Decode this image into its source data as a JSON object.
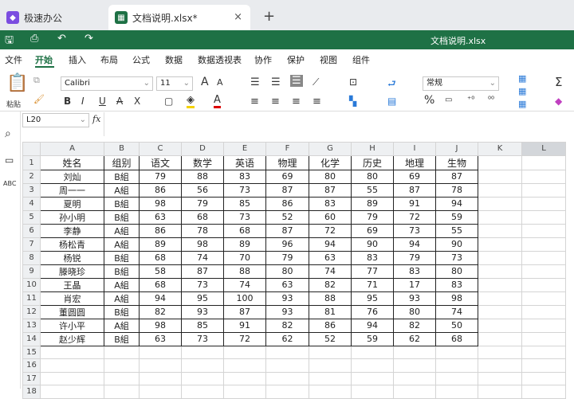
{
  "tabs": [
    {
      "label": "极速办公"
    },
    {
      "label": "文档说明.xlsx*",
      "close": "×"
    }
  ],
  "new_tab": "+",
  "doc_title": "文档说明.xlsx",
  "menu": [
    "文件",
    "开始",
    "插入",
    "布局",
    "公式",
    "数据",
    "数据透视表",
    "协作",
    "保护",
    "视图",
    "组件"
  ],
  "ribbon": {
    "paste": "粘贴",
    "font": "Calibri",
    "size": "11",
    "grow": "A",
    "shrink": "A",
    "bold": "B",
    "italic": "I",
    "underline": "U",
    "strike": "A",
    "sub": "X",
    "fontcolor": "A",
    "numfmt": "常规",
    "percent": "%",
    "sigma": "Σ"
  },
  "formula": {
    "cellref": "L20",
    "fx": "fx",
    "value": ""
  },
  "columns": [
    "",
    "A",
    "B",
    "C",
    "D",
    "E",
    "F",
    "G",
    "H",
    "I",
    "J",
    "K",
    "L"
  ],
  "rows": [
    [
      "1",
      "姓名",
      "组别",
      "语文",
      "数学",
      "英语",
      "物理",
      "化学",
      "历史",
      "地理",
      "生物"
    ],
    [
      "2",
      "刘灿",
      "B組",
      "79",
      "88",
      "83",
      "69",
      "80",
      "80",
      "69",
      "87"
    ],
    [
      "3",
      "周一一",
      "A組",
      "86",
      "56",
      "73",
      "87",
      "87",
      "55",
      "87",
      "78"
    ],
    [
      "4",
      "夏明",
      "B組",
      "98",
      "79",
      "85",
      "86",
      "83",
      "89",
      "91",
      "94"
    ],
    [
      "5",
      "孙小明",
      "B組",
      "63",
      "68",
      "73",
      "52",
      "60",
      "79",
      "72",
      "59"
    ],
    [
      "6",
      "李静",
      "A組",
      "86",
      "78",
      "68",
      "87",
      "72",
      "69",
      "73",
      "55"
    ],
    [
      "7",
      "杨松青",
      "A組",
      "89",
      "98",
      "89",
      "96",
      "94",
      "90",
      "94",
      "90"
    ],
    [
      "8",
      "杨锐",
      "B組",
      "68",
      "74",
      "70",
      "79",
      "63",
      "83",
      "79",
      "73"
    ],
    [
      "9",
      "滕晓珍",
      "B組",
      "58",
      "87",
      "88",
      "80",
      "74",
      "77",
      "83",
      "80"
    ],
    [
      "10",
      "王晶",
      "A組",
      "68",
      "73",
      "74",
      "63",
      "82",
      "71",
      "17",
      "83"
    ],
    [
      "11",
      "肖宏",
      "A組",
      "94",
      "95",
      "100",
      "93",
      "88",
      "95",
      "93",
      "98"
    ],
    [
      "12",
      "董圆圆",
      "B組",
      "82",
      "93",
      "87",
      "93",
      "81",
      "76",
      "80",
      "74"
    ],
    [
      "13",
      "许小平",
      "A組",
      "98",
      "85",
      "91",
      "82",
      "86",
      "94",
      "82",
      "50"
    ],
    [
      "14",
      "赵少辉",
      "B組",
      "63",
      "73",
      "72",
      "62",
      "52",
      "59",
      "62",
      "68"
    ],
    [
      "15"
    ],
    [
      "16"
    ],
    [
      "17"
    ],
    [
      "18"
    ]
  ],
  "colors": {
    "accent": "#1e7145",
    "header_bg": "#eef0f2"
  }
}
